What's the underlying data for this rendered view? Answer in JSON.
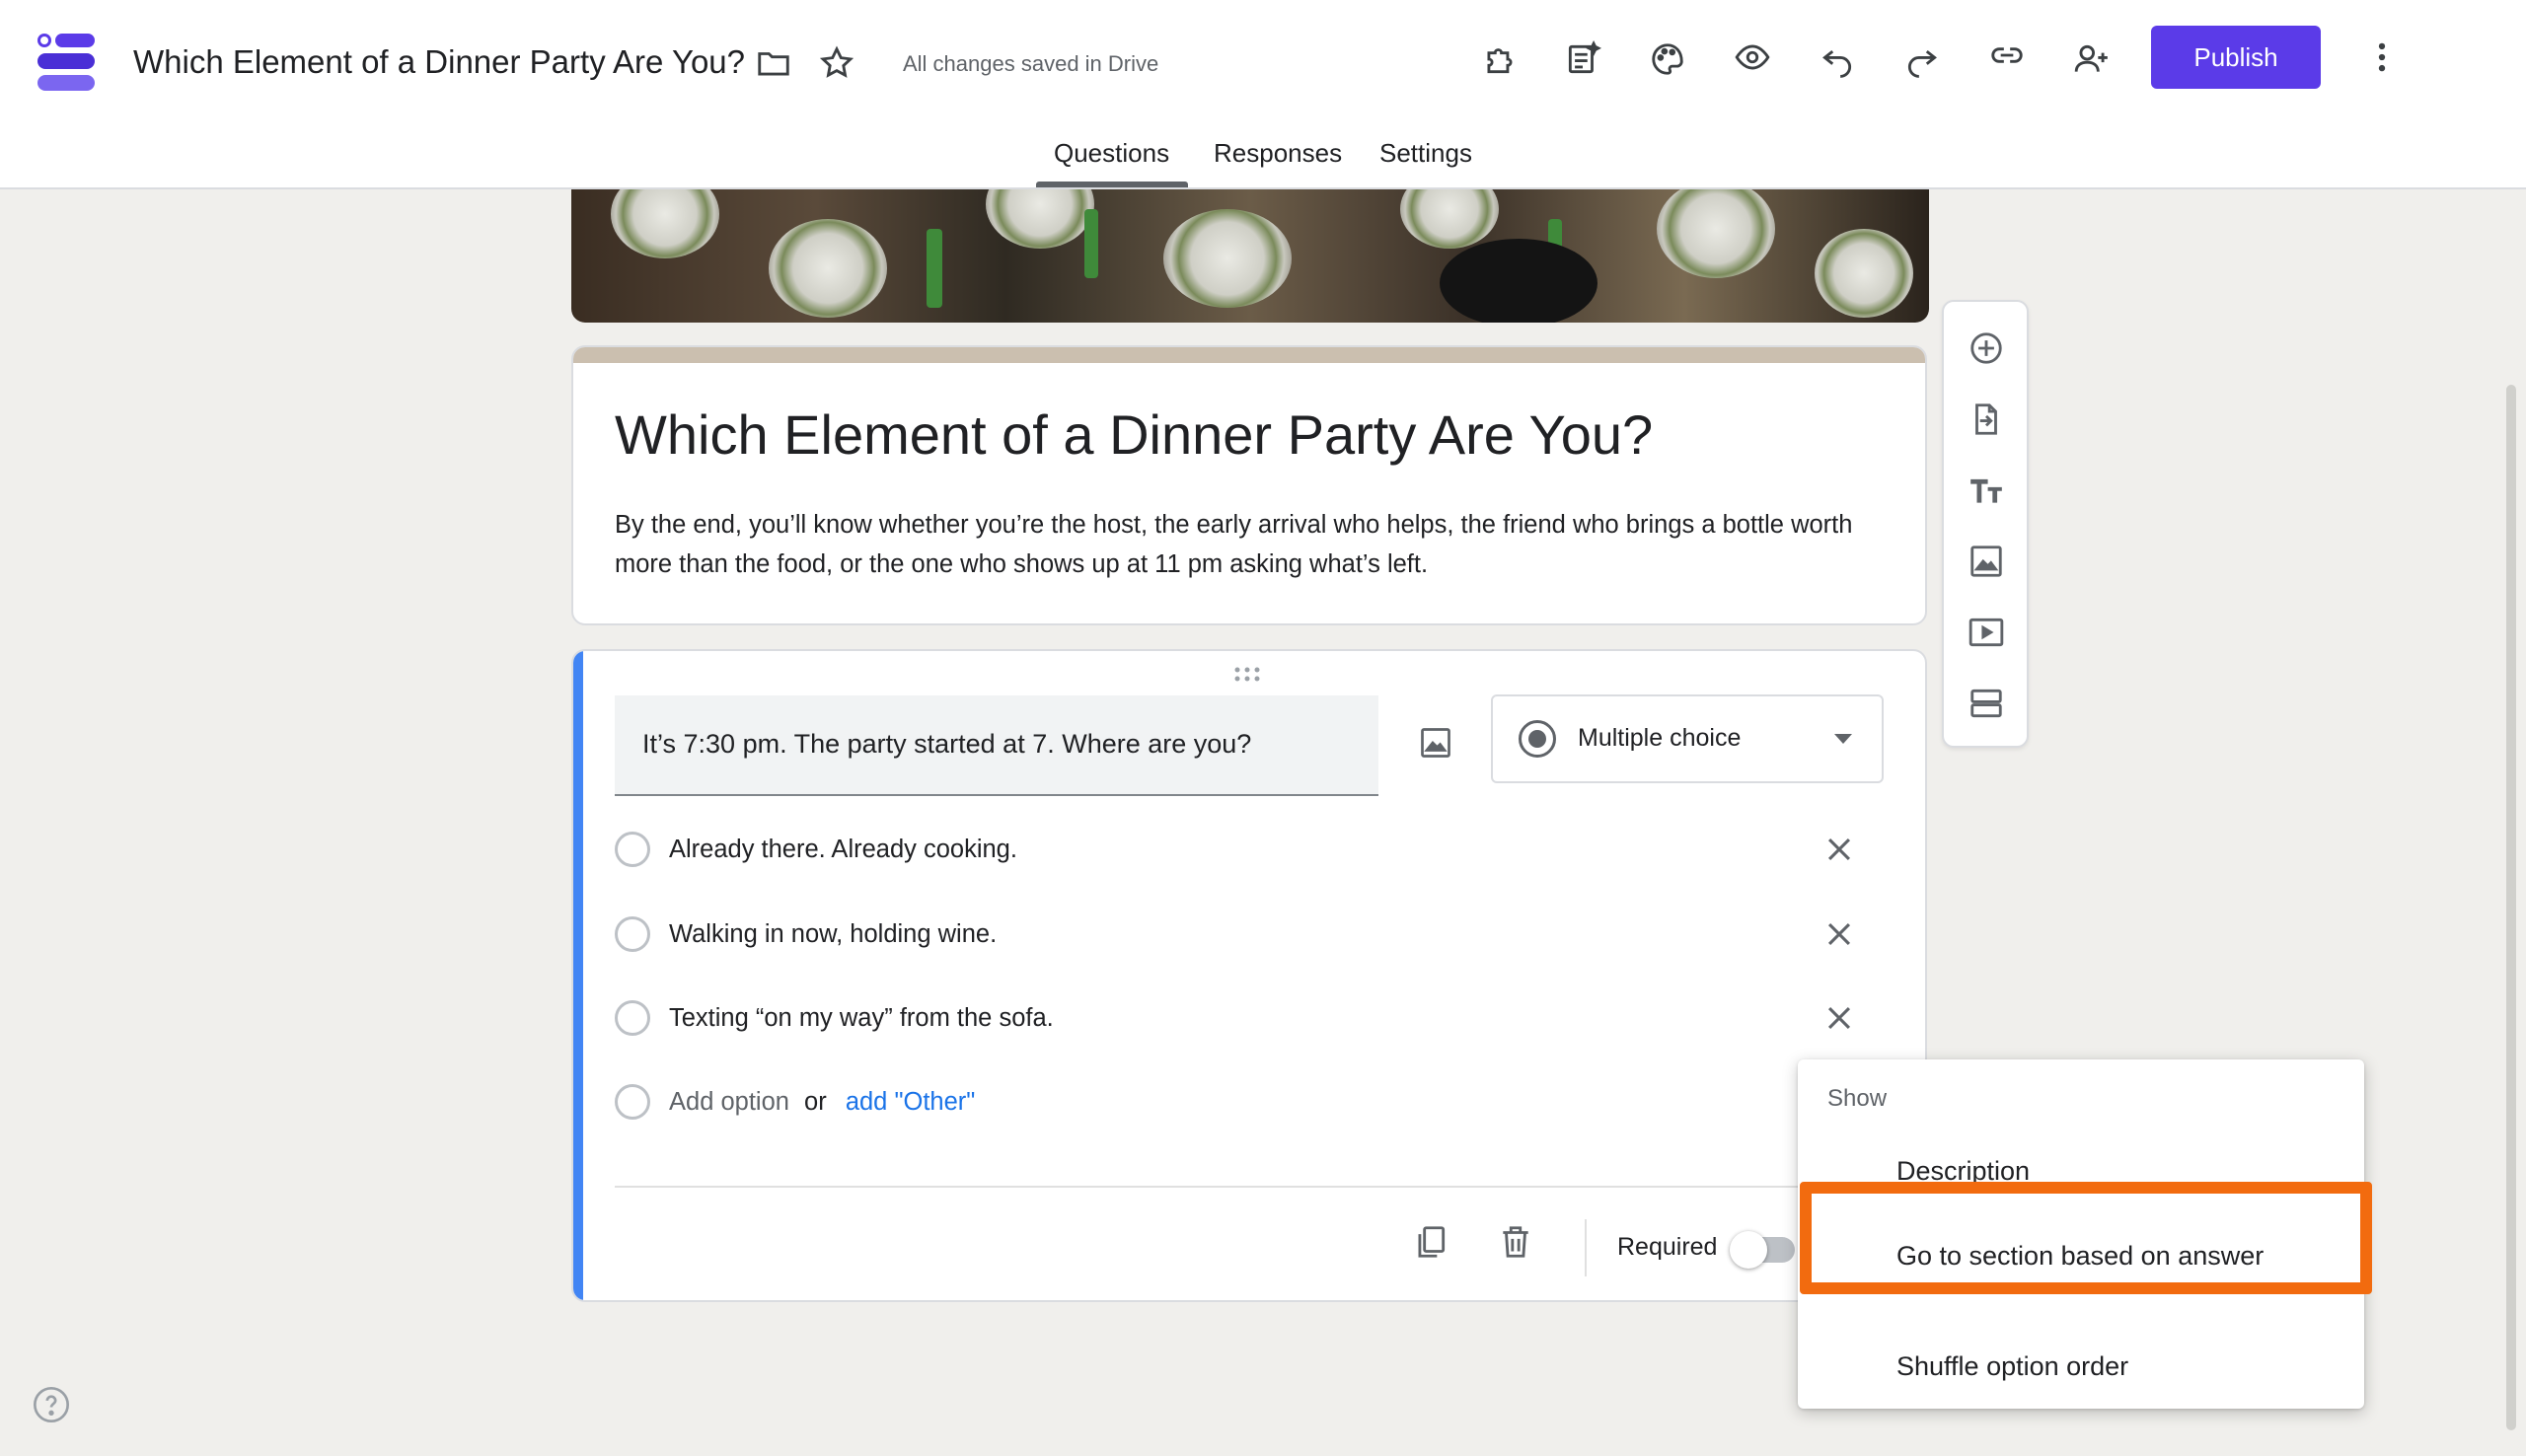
{
  "header": {
    "doc_title": "Which Element of a Dinner Party Are You?",
    "saved_status": "All changes saved in Drive",
    "publish_label": "Publish",
    "icons": [
      "folder-icon",
      "star-icon",
      "addon-icon",
      "customize-icon",
      "palette-icon",
      "preview-icon",
      "undo-icon",
      "redo-icon",
      "link-icon",
      "add-collaborator-icon",
      "more-vert-icon"
    ],
    "accent_color": "#5b3be8"
  },
  "tabs": [
    {
      "label": "Questions",
      "active": true
    },
    {
      "label": "Responses",
      "active": false
    },
    {
      "label": "Settings",
      "active": false
    }
  ],
  "form": {
    "title": "Which Element of a Dinner Party Are You?",
    "description": "By the end, you’ll know whether you’re the host, the early arrival who helps, the friend who brings a bottle worth more than the food, or the one who shows up at 11 pm asking what’s left."
  },
  "question": {
    "text": "It’s 7:30 pm. The party started at 7. Where are you?",
    "type": "Multiple choice",
    "options": [
      "Already there. Already cooking.",
      "Walking in now, holding wine.",
      "Texting “on my way” from the sofa."
    ],
    "add_option": "Add option",
    "or": "or",
    "add_other": "add \"Other\"",
    "required_label": "Required",
    "required": false,
    "accent_color": "#4285f4"
  },
  "side_toolbar": {
    "icons": [
      "add-question-icon",
      "import-questions-icon",
      "add-title-icon",
      "add-image-icon",
      "add-video-icon",
      "add-section-icon"
    ]
  },
  "menu": {
    "header": "Show",
    "items": [
      "Description",
      "Go to section based on answer",
      "Shuffle option order"
    ],
    "highlighted": "Go to section based on answer",
    "highlight_color": "#f26b0f"
  }
}
